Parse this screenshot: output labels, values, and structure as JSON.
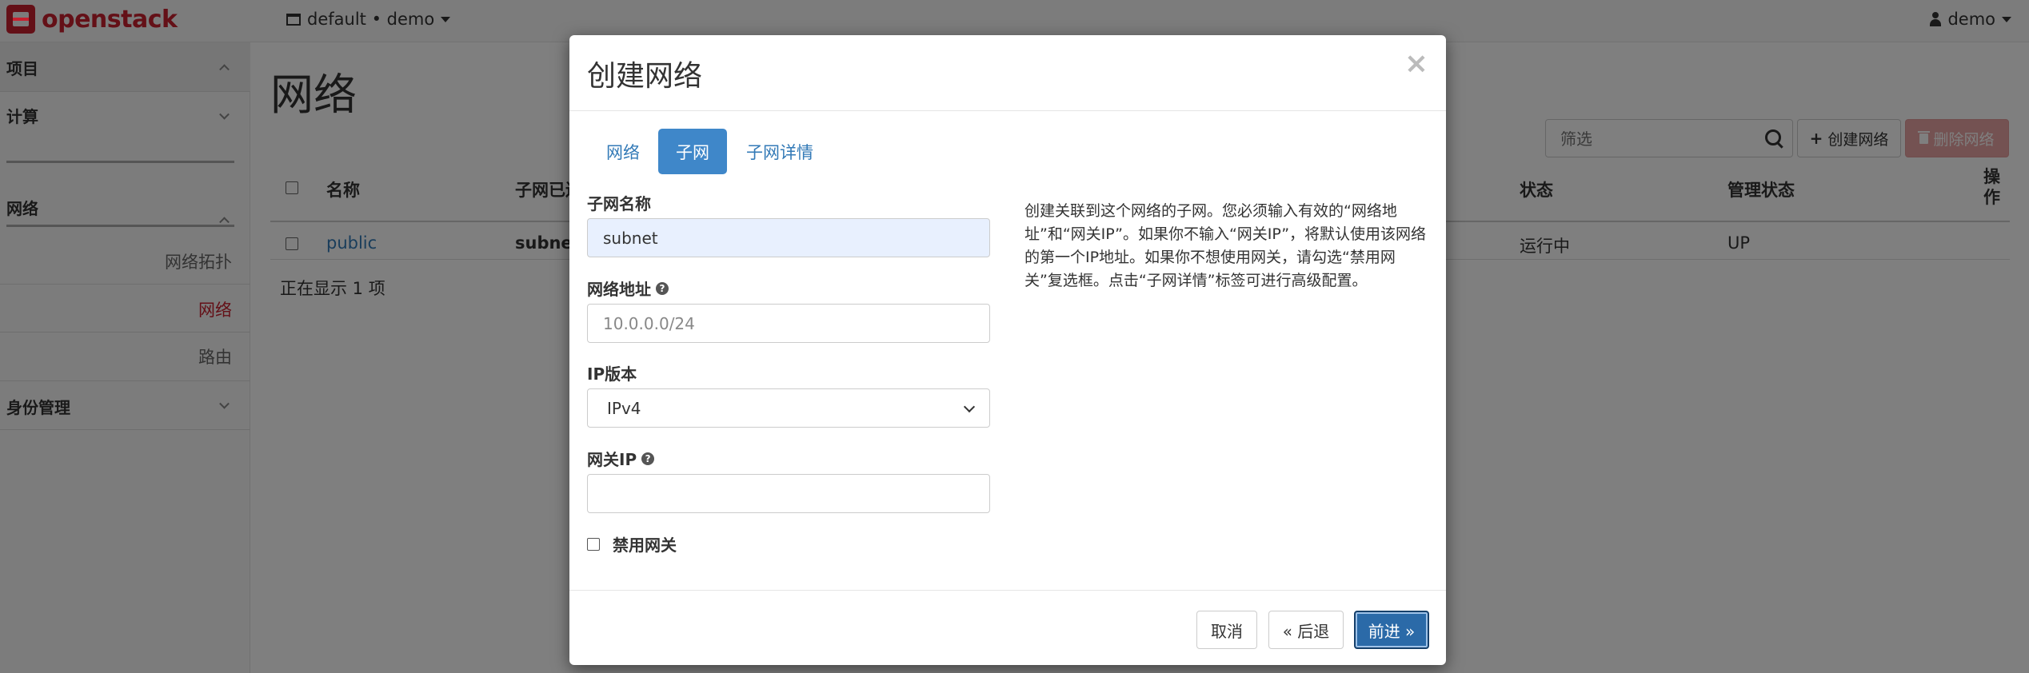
{
  "navbar": {
    "brand": "openstack",
    "project_picker": "default • demo",
    "user": "demo"
  },
  "sidebar": {
    "sections": [
      {
        "label": "项目",
        "state": "expanded"
      },
      {
        "label": "计算",
        "state": "collapsed"
      },
      {
        "label": "网络",
        "state": "expanded"
      },
      {
        "label": "身份管理",
        "state": "collapsed"
      }
    ],
    "network_items": [
      {
        "label": "网络拓扑",
        "active": false
      },
      {
        "label": "网络",
        "active": true
      },
      {
        "label": "路由",
        "active": false
      }
    ]
  },
  "page": {
    "title": "网络",
    "filter_placeholder": "筛选",
    "create_button": "创建网络",
    "delete_button": "删除网络",
    "table": {
      "columns": [
        "名称",
        "子网已连",
        "状态",
        "管理状态",
        "操作"
      ],
      "rows": [
        {
          "name": "public",
          "subnet": "subnet",
          "status": "运行中",
          "admin_state": "UP"
        }
      ]
    },
    "showing": "正在显示 1 项"
  },
  "modal": {
    "title": "创建网络",
    "close": "×",
    "tabs": [
      {
        "label": "网络",
        "active": false
      },
      {
        "label": "子网",
        "active": true
      },
      {
        "label": "子网详情",
        "active": false
      }
    ],
    "fields": {
      "subnet_name": {
        "label": "子网名称",
        "value": "subnet"
      },
      "network_address": {
        "label": "网络地址",
        "placeholder": "10.0.0.0/24",
        "value": ""
      },
      "ip_version": {
        "label": "IP版本",
        "selected": "IPv4"
      },
      "gateway_ip": {
        "label": "网关IP",
        "value": ""
      },
      "disable_gateway": {
        "label": "禁用网关",
        "checked": false
      }
    },
    "help_text": "创建关联到这个网络的子网。您必须输入有效的“网络地址”和“网关IP”。如果你不输入“网关IP”，将默认使用该网络的第一个IP地址。如果你不想使用网关，请勾选“禁用网关”复选框。点击“子网详情”标签可进行高级配置。",
    "buttons": {
      "cancel": "取消",
      "back": "« 后退",
      "next": "前进 »"
    }
  }
}
